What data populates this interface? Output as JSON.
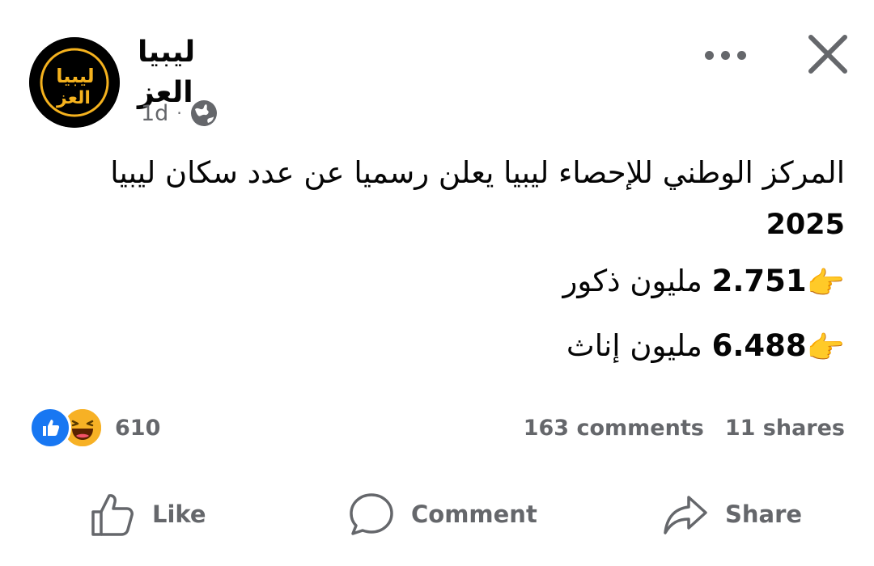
{
  "post": {
    "page_name": "ليبيا العز",
    "avatar_text_line1": "ليبيا",
    "avatar_text_line2": "العز",
    "time": "1d",
    "separator": "·",
    "audience_icon": "globe-icon",
    "text_line1": "المركز الوطني للإحصاء ليبيا يعلن رسميا عن عدد سكان ليبيا",
    "year": "2025",
    "stats": [
      {
        "number": "2.751",
        "label": "مليون ذكور",
        "icon": "👉"
      },
      {
        "number": "6.488",
        "label": "مليون إناث",
        "icon": "👉"
      }
    ]
  },
  "engagement": {
    "reaction_count": "610",
    "comments": "163 comments",
    "shares": "11 shares"
  },
  "actions": {
    "like": "Like",
    "comment": "Comment",
    "share": "Share"
  },
  "colors": {
    "accent_blue": "#1877f2",
    "haha_yellow": "#f7b125",
    "secondary_text": "#65676b",
    "avatar_gold": "#f5b21e"
  }
}
